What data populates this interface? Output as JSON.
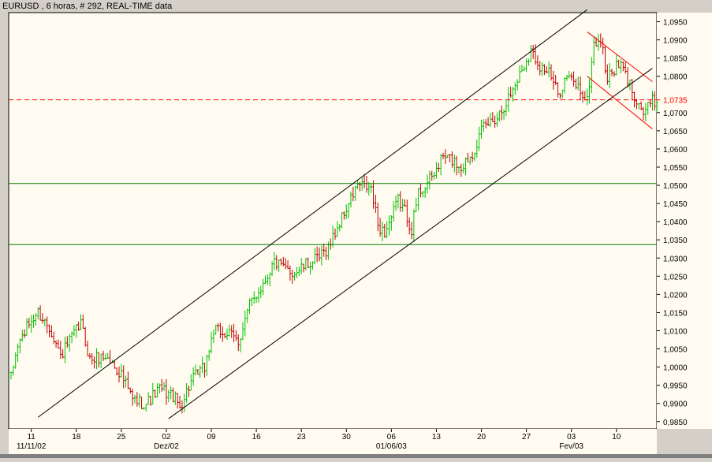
{
  "header": {
    "title": "EURUSD , 6 horas, # 292, REAL-TIME data"
  },
  "colors": {
    "background": "#d4d0c8",
    "plot_background": "#fffbf0",
    "up_bar": "#00c000",
    "down_bar": "#c00000",
    "channel_line": "#000000",
    "support_line": "#008000",
    "reference_line": "#ff0000",
    "scrollbar": "#808080"
  },
  "chart_data": {
    "type": "ohlc",
    "symbol": "EURUSD",
    "timeframe": "6 horas",
    "grid": false,
    "ylim": [
      0.983,
      1.0975
    ],
    "y_ticks": [
      "1,0950",
      "1,0900",
      "1,0850",
      "1,0800",
      "1,0735",
      "1,0700",
      "1,0650",
      "1,0600",
      "1,0550",
      "1,0500",
      "1,0450",
      "1,0400",
      "1,0350",
      "1,0300",
      "1,0250",
      "1,0200",
      "1,0150",
      "1,0100",
      "1,0050",
      "1,0000",
      "0,9950",
      "0,9900",
      "0,9850"
    ],
    "y_tick_values": [
      1.095,
      1.09,
      1.085,
      1.08,
      1.0735,
      1.07,
      1.065,
      1.06,
      1.055,
      1.05,
      1.045,
      1.04,
      1.035,
      1.03,
      1.025,
      1.02,
      1.015,
      1.01,
      1.005,
      1.0,
      0.995,
      0.99,
      0.985
    ],
    "highlight_tick": "1,0735",
    "x_ticks": [
      {
        "label": "11",
        "sub": "11/11/02",
        "bar": 9
      },
      {
        "label": "18",
        "sub": "",
        "bar": 29
      },
      {
        "label": "25",
        "sub": "",
        "bar": 49
      },
      {
        "label": "02",
        "sub": "Dez/02",
        "bar": 69
      },
      {
        "label": "09",
        "sub": "",
        "bar": 89
      },
      {
        "label": "16",
        "sub": "",
        "bar": 109
      },
      {
        "label": "23",
        "sub": "",
        "bar": 129
      },
      {
        "label": "30",
        "sub": "",
        "bar": 149
      },
      {
        "label": "06",
        "sub": "01/06/03",
        "bar": 169
      },
      {
        "label": "13",
        "sub": "",
        "bar": 189
      },
      {
        "label": "20",
        "sub": "",
        "bar": 209
      },
      {
        "label": "27",
        "sub": "",
        "bar": 229
      },
      {
        "label": "03",
        "sub": "Fev/03",
        "bar": 249
      },
      {
        "label": "10",
        "sub": "",
        "bar": 269
      }
    ],
    "anchors": [
      [
        0,
        0.997
      ],
      [
        3,
        1.006
      ],
      [
        8,
        1.012
      ],
      [
        12,
        1.015
      ],
      [
        18,
        1.01
      ],
      [
        22,
        1.003
      ],
      [
        27,
        1.008
      ],
      [
        31,
        1.012
      ],
      [
        35,
        1.002
      ],
      [
        42,
        1.003
      ],
      [
        49,
        0.998
      ],
      [
        54,
        0.991
      ],
      [
        60,
        0.99
      ],
      [
        66,
        0.994
      ],
      [
        72,
        0.992
      ],
      [
        75,
        0.989
      ],
      [
        80,
        0.996
      ],
      [
        86,
        1.0
      ],
      [
        90,
        1.01
      ],
      [
        97,
        1.009
      ],
      [
        101,
        1.007
      ],
      [
        106,
        1.017
      ],
      [
        112,
        1.023
      ],
      [
        117,
        1.029
      ],
      [
        121,
        1.027
      ],
      [
        126,
        1.026
      ],
      [
        131,
        1.028
      ],
      [
        137,
        1.03
      ],
      [
        141,
        1.033
      ],
      [
        147,
        1.041
      ],
      [
        154,
        1.05
      ],
      [
        160,
        1.049
      ],
      [
        163,
        1.039
      ],
      [
        166,
        1.037
      ],
      [
        169,
        1.041
      ],
      [
        172,
        1.046
      ],
      [
        175,
        1.043
      ],
      [
        178,
        1.038
      ],
      [
        181,
        1.048
      ],
      [
        187,
        1.052
      ],
      [
        192,
        1.058
      ],
      [
        196,
        1.057
      ],
      [
        200,
        1.055
      ],
      [
        205,
        1.059
      ],
      [
        210,
        1.066
      ],
      [
        216,
        1.069
      ],
      [
        222,
        1.075
      ],
      [
        227,
        1.082
      ],
      [
        231,
        1.087
      ],
      [
        235,
        1.083
      ],
      [
        239,
        1.081
      ],
      [
        243,
        1.075
      ],
      [
        247,
        1.08
      ],
      [
        252,
        1.077
      ],
      [
        256,
        1.073
      ],
      [
        259,
        1.089
      ],
      [
        262,
        1.09
      ],
      [
        265,
        1.079
      ],
      [
        268,
        1.082
      ],
      [
        271,
        1.083
      ],
      [
        274,
        1.079
      ],
      [
        277,
        1.075
      ],
      [
        281,
        1.07
      ],
      [
        285,
        1.073
      ]
    ],
    "channel_lines": [
      {
        "name": "upper-channel",
        "x1": 12,
        "y1": 0.9862,
        "x2": 256,
        "y2": 1.0983
      },
      {
        "name": "lower-channel",
        "x1": 70,
        "y1": 0.9858,
        "x2": 285,
        "y2": 1.0822
      },
      {
        "name": "wedge-upper",
        "x1": 256,
        "y1": 1.0922,
        "x2": 285,
        "y2": 1.0785
      },
      {
        "name": "wedge-lower",
        "x1": 256,
        "y1": 1.08,
        "x2": 285,
        "y2": 1.0655
      }
    ],
    "horizontal_lines": [
      {
        "name": "resistance-line",
        "y": 1.0505,
        "style": "solid",
        "color": "#008000"
      },
      {
        "name": "support-line",
        "y": 1.0337,
        "style": "solid",
        "color": "#008000"
      },
      {
        "name": "reference-line",
        "y": 1.0735,
        "style": "dashed",
        "color": "#ff0000"
      }
    ],
    "bar_count": 288
  }
}
